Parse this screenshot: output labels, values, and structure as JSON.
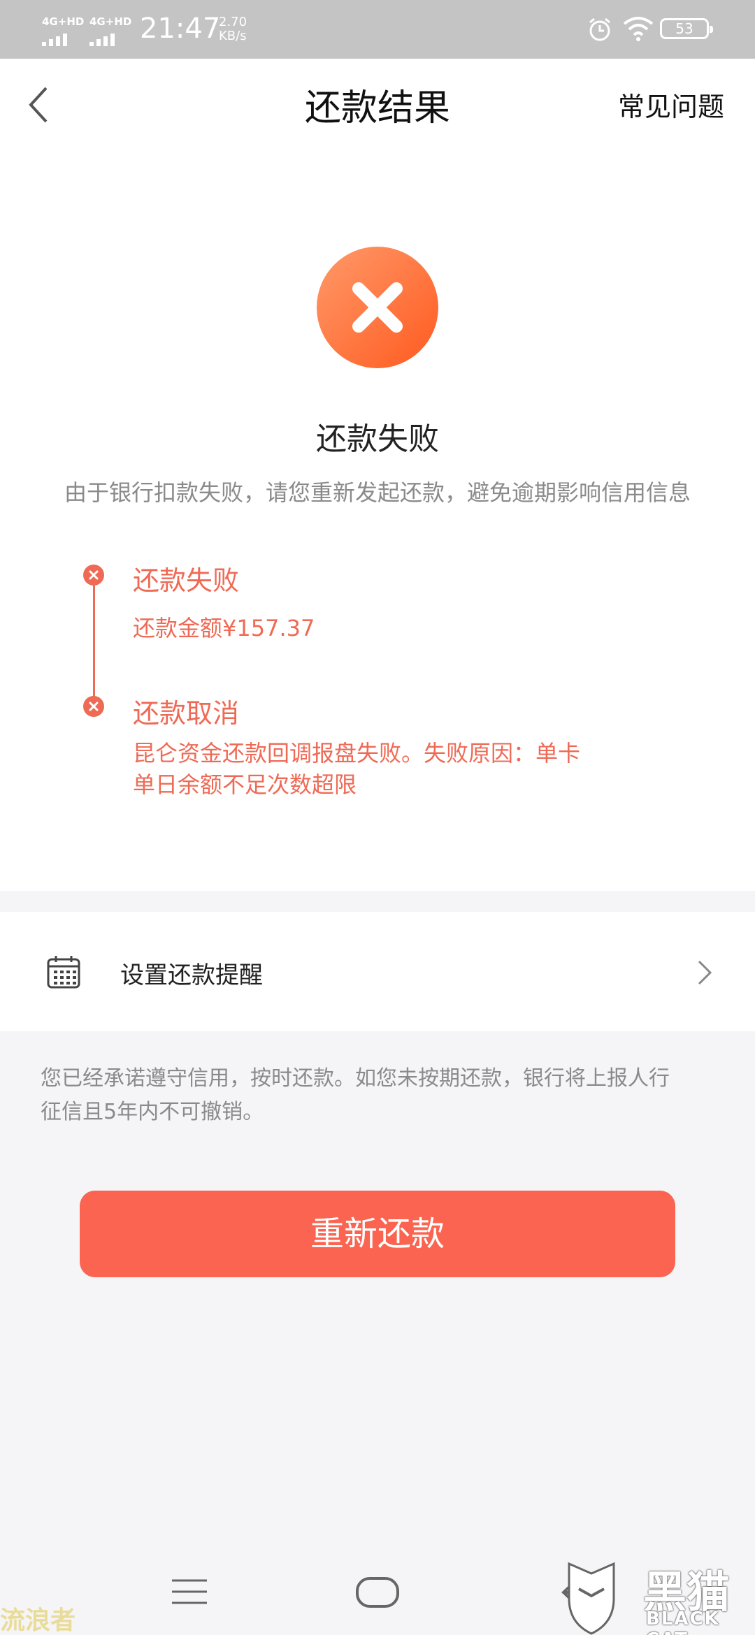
{
  "status_bar": {
    "network_1": "4G+HD",
    "network_2": "4G+HD",
    "time": "21:47",
    "speed_value": "2.70",
    "speed_unit": "KB/s",
    "battery": "53"
  },
  "nav": {
    "title": "还款结果",
    "faq": "常见问题",
    "back_icon": "chevron-left-icon"
  },
  "result": {
    "icon": "close-circle-icon",
    "title": "还款失败",
    "description": "由于银行扣款失败，请您重新发起还款，避免逾期影响信用信息"
  },
  "timeline": [
    {
      "title": "还款失败",
      "detail": "还款金额¥157.37"
    },
    {
      "title": "还款取消",
      "detail_line1": "昆仑资金还款回调报盘失败。失败原因：单卡",
      "detail_line2": "单日余额不足次数超限"
    }
  ],
  "reminder": {
    "label": "设置还款提醒",
    "icon": "calendar-icon"
  },
  "notice": {
    "line1": "您已经承诺遵守信用，按时还款。如您未按期还款，银行将上报人行",
    "line2": "征信且5年内不可撤销。"
  },
  "retry_button": "重新还款",
  "watermark": {
    "left": "流浪者",
    "logo_cn": "黑猫",
    "logo_en": "BLACK CAT"
  },
  "colors": {
    "accent": "#fa6450",
    "timeline": "#ef6a55",
    "status_bar": "#c4c4c4"
  }
}
